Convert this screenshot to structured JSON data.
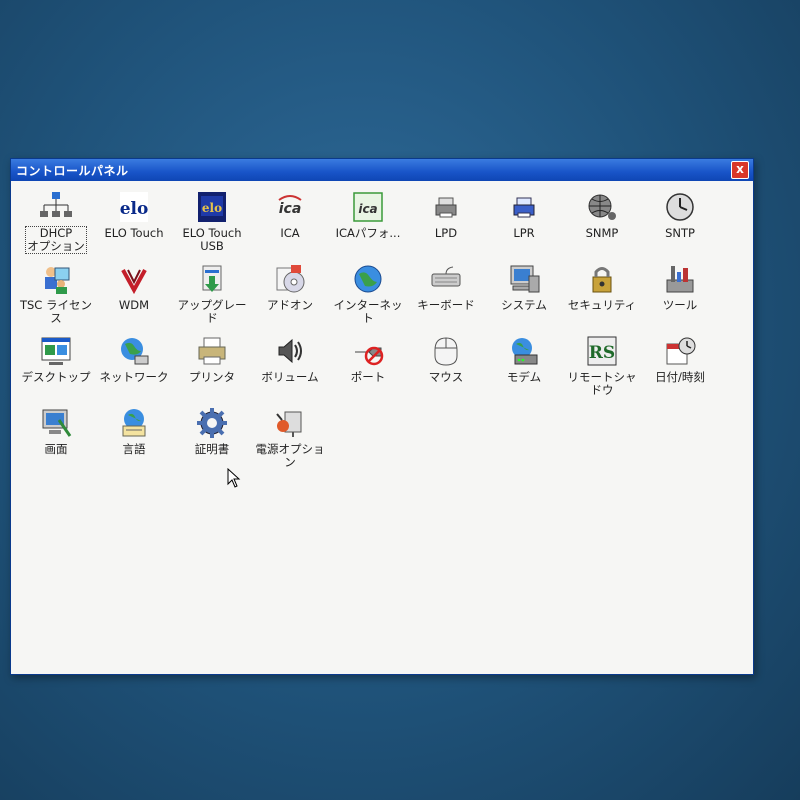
{
  "window": {
    "title": "コントロールパネル",
    "close_label": "x"
  },
  "items": [
    {
      "label": "DHCP\nオプション",
      "icon": "network-tree-icon"
    },
    {
      "label": "ELO Touch",
      "icon": "elo-logo-icon"
    },
    {
      "label": "ELO Touch\nUSB",
      "icon": "elo-usb-logo-icon"
    },
    {
      "label": "ICA",
      "icon": "ica-logo-icon"
    },
    {
      "label": "ICAパフォ...",
      "icon": "ica-performance-icon"
    },
    {
      "label": "LPD",
      "icon": "printer-small-icon"
    },
    {
      "label": "LPR",
      "icon": "printer-blue-icon"
    },
    {
      "label": "SNMP",
      "icon": "snmp-globe-icon"
    },
    {
      "label": "SNTP",
      "icon": "clock-icon"
    },
    {
      "label": "TSC ライセンス",
      "icon": "license-people-icon"
    },
    {
      "label": "WDM",
      "icon": "wdm-logo-icon"
    },
    {
      "label": "アップグレード",
      "icon": "upgrade-icon"
    },
    {
      "label": "アドオン",
      "icon": "addon-cd-icon"
    },
    {
      "label": "インターネット",
      "icon": "internet-globe-icon"
    },
    {
      "label": "キーボード",
      "icon": "keyboard-icon"
    },
    {
      "label": "システム",
      "icon": "computer-icon"
    },
    {
      "label": "セキュリティ",
      "icon": "lock-icon"
    },
    {
      "label": "ツール",
      "icon": "tools-icon"
    },
    {
      "label": "デスクトップ",
      "icon": "desktop-icon"
    },
    {
      "label": "ネットワーク",
      "icon": "network-globe-icon"
    },
    {
      "label": "プリンタ",
      "icon": "printer-icon"
    },
    {
      "label": "ボリューム",
      "icon": "speaker-icon"
    },
    {
      "label": "ポート",
      "icon": "port-icon"
    },
    {
      "label": "マウス",
      "icon": "mouse-icon"
    },
    {
      "label": "モデム",
      "icon": "modem-icon"
    },
    {
      "label": "リモートシャドウ",
      "icon": "remote-shadow-icon"
    },
    {
      "label": "日付/時刻",
      "icon": "date-time-icon"
    },
    {
      "label": "画面",
      "icon": "display-icon"
    },
    {
      "label": "言語",
      "icon": "language-globe-icon"
    },
    {
      "label": "証明書",
      "icon": "gear-certificate-icon"
    },
    {
      "label": "電源オプション",
      "icon": "power-options-icon"
    }
  ],
  "colors": {
    "titlebar": "#1854c8",
    "close": "#d9372a",
    "desktop": "#1f5279"
  }
}
